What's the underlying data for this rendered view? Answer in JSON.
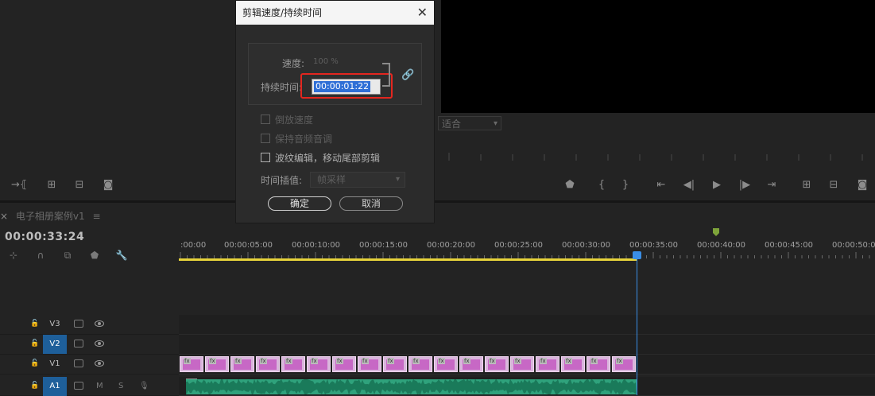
{
  "dialog": {
    "title": "剪辑速度/持续时间",
    "speed_label": "速度:",
    "speed_value": "100 %",
    "duration_label": "持续时间:",
    "duration_value": "00:00:01:22",
    "reverse_label": "倒放速度",
    "maintain_pitch_label": "保持音频音调",
    "ripple_label": "波纹编辑，移动尾部剪辑",
    "interp_label": "时间插值:",
    "interp_value": "帧采样",
    "ok_label": "确定",
    "cancel_label": "取消",
    "reverse_checked": false,
    "maintain_pitch_checked": false,
    "ripple_checked": false
  },
  "program": {
    "fit_value": "适合"
  },
  "timeline": {
    "sequence_name": "电子相册案例v1",
    "timecode": "00:00:33:24",
    "ruler_labels": [
      ":00:00",
      "00:00:05:00",
      "00:00:10:00",
      "00:00:15:00",
      "00:00:20:00",
      "00:00:25:00",
      "00:00:30:00",
      "00:00:35:00",
      "00:00:40:00",
      "00:00:45:00",
      "00:00:50:00"
    ],
    "tracks": [
      {
        "name": "V3",
        "active": false
      },
      {
        "name": "V2",
        "active": true
      },
      {
        "name": "V1",
        "active": false
      },
      {
        "name": "A1",
        "active": true
      }
    ],
    "audio_mute": "M",
    "audio_solo": "S",
    "clip_badge": "fx"
  },
  "colors": {
    "accent": "#1e5f9a",
    "playhead": "#3a8ee6",
    "work_area": "#e6d23a",
    "video_clip": "#d9b5dc",
    "audio_clip": "#2fa27c",
    "highlight": "#e3261f"
  }
}
